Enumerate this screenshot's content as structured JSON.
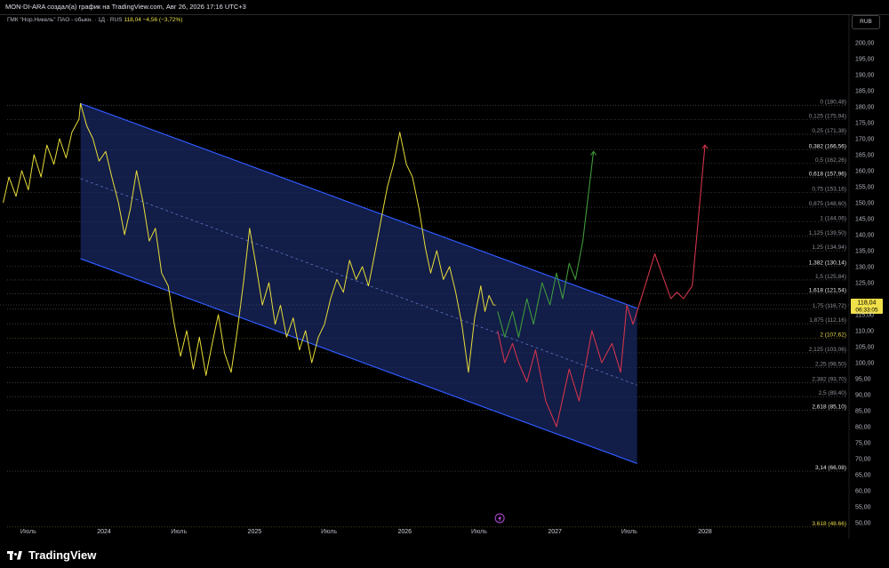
{
  "header": {
    "caption": "MON-DI-ARA создал(а) график на TradingView.com, Авг 26, 2026 17:16 UTC+3"
  },
  "legend": {
    "symbol": "ГМК \"Нор.Никель\" ПАО - обыкн. · 1Д · RUS",
    "price": "118,04",
    "change": "−4,56 (−3,72%)"
  },
  "currency_button": "RUB",
  "footer": {
    "brand": "TradingView"
  },
  "colors": {
    "price_line": "#e8dd3a",
    "channel_border": "#2f5bff",
    "channel_fill": "#1a2a66",
    "forecast_bull": "#3f9a3a",
    "forecast_bear": "#d0344a",
    "midline": "#5a74c0",
    "fib_dotted": "#5c5f66",
    "current_price_tag": "#f0e04a"
  },
  "chart_data": {
    "type": "line",
    "y_axis": {
      "min": 45,
      "max": 205,
      "ticks": [
        "200,00",
        "195,00",
        "190,00",
        "185,00",
        "180,00",
        "175,00",
        "170,00",
        "165,00",
        "160,00",
        "155,00",
        "150,00",
        "145,00",
        "140,00",
        "135,00",
        "130,00",
        "125,00",
        "120,00",
        "115,00",
        "110,00",
        "105,00",
        "100,00",
        "95,00",
        "90,00",
        "85,00",
        "80,00",
        "75,00",
        "70,00",
        "65,00",
        "60,00",
        "55,00",
        "50,00"
      ],
      "tick_values": [
        200,
        195,
        190,
        185,
        180,
        175,
        170,
        165,
        160,
        155,
        150,
        145,
        140,
        135,
        130,
        125,
        120,
        115,
        110,
        105,
        100,
        95,
        90,
        85,
        80,
        75,
        70,
        65,
        60,
        55,
        50
      ]
    },
    "x_axis": {
      "labels": [
        "Июль",
        "2024",
        "Июль",
        "2025",
        "Июль",
        "2026",
        "Июль",
        "2027",
        "Июль",
        "2028"
      ],
      "dates": [
        "2023-07-01",
        "2024-01-01",
        "2024-07-01",
        "2025-01-01",
        "2025-07-01",
        "2026-01-01",
        "2026-07-01",
        "2027-01-01",
        "2027-07-01",
        "2028-01-01"
      ],
      "year_labels": [
        "2024",
        "2025",
        "2026",
        "2027",
        "2028"
      ]
    },
    "current_price": {
      "value": "118,04",
      "countdown": "06:33:05",
      "numeric": 118.04
    },
    "fib_levels": [
      {
        "label": "0 (180,48)",
        "value": 180.48
      },
      {
        "label": "0,125 (175,94)",
        "value": 175.94
      },
      {
        "label": "0,25 (171,38)",
        "value": 171.38
      },
      {
        "label": "0,382 (166,56)",
        "value": 166.56,
        "highlight": true
      },
      {
        "label": "0,5 (162,26)",
        "value": 162.26
      },
      {
        "label": "0,618 (157,96)",
        "value": 157.96,
        "highlight": true
      },
      {
        "label": "0,75 (153,16)",
        "value": 153.16
      },
      {
        "label": "0,875 (148,60)",
        "value": 148.6
      },
      {
        "label": "1 (144,06)",
        "value": 144.06
      },
      {
        "label": "1,125 (139,50)",
        "value": 139.5
      },
      {
        "label": "1,25 (134,94)",
        "value": 134.94
      },
      {
        "label": "1,382 (130,14)",
        "value": 130.14,
        "highlight": true
      },
      {
        "label": "1,5 (125,84)",
        "value": 125.84
      },
      {
        "label": "1,618 (121,54)",
        "value": 121.54,
        "highlight": true
      },
      {
        "label": "1,75 (116,72)",
        "value": 116.72
      },
      {
        "label": "1,875 (112,16)",
        "value": 112.16
      },
      {
        "label": "2 (107,62)",
        "value": 107.62,
        "gold": true
      },
      {
        "label": "2,125 (103,06)",
        "value": 103.06
      },
      {
        "label": "2,25 (98,50)",
        "value": 98.5
      },
      {
        "label": "2,382 (93,70)",
        "value": 93.7
      },
      {
        "label": "2,5 (89,40)",
        "value": 89.4
      },
      {
        "label": "2,618 (85,10)",
        "value": 85.1,
        "highlight": true
      },
      {
        "label": "3,14 (66,08)",
        "value": 66.08,
        "highlight": true
      },
      {
        "label": "3.618 (48.66)",
        "value": 48.66,
        "gold": true
      }
    ],
    "channel": {
      "upper": [
        [
          "2023-11-05",
          181.0
        ],
        [
          "2027-07-20",
          117.0
        ]
      ],
      "lower": [
        [
          "2023-11-05",
          132.5
        ],
        [
          "2027-07-20",
          68.5
        ]
      ],
      "mid": [
        [
          "2023-11-05",
          157.5
        ],
        [
          "2027-07-20",
          93.0
        ]
      ]
    },
    "series": [
      {
        "key": "price",
        "values": [
          [
            "2023-05-01",
            150
          ],
          [
            "2023-05-15",
            158
          ],
          [
            "2023-06-01",
            152
          ],
          [
            "2023-06-15",
            160
          ],
          [
            "2023-07-01",
            154
          ],
          [
            "2023-07-15",
            165
          ],
          [
            "2023-08-01",
            158
          ],
          [
            "2023-08-15",
            168
          ],
          [
            "2023-09-01",
            162
          ],
          [
            "2023-09-15",
            170
          ],
          [
            "2023-10-01",
            164
          ],
          [
            "2023-10-15",
            172
          ],
          [
            "2023-11-01",
            176
          ],
          [
            "2023-11-05",
            181
          ],
          [
            "2023-11-20",
            174
          ],
          [
            "2023-12-05",
            170
          ],
          [
            "2023-12-20",
            163
          ],
          [
            "2024-01-05",
            166
          ],
          [
            "2024-01-20",
            158
          ],
          [
            "2024-02-05",
            150
          ],
          [
            "2024-02-20",
            140
          ],
          [
            "2024-03-05",
            148
          ],
          [
            "2024-03-20",
            160
          ],
          [
            "2024-04-05",
            150
          ],
          [
            "2024-04-20",
            138
          ],
          [
            "2024-05-05",
            142
          ],
          [
            "2024-05-20",
            128
          ],
          [
            "2024-06-05",
            124
          ],
          [
            "2024-06-20",
            112
          ],
          [
            "2024-07-05",
            102
          ],
          [
            "2024-07-20",
            110
          ],
          [
            "2024-08-05",
            98
          ],
          [
            "2024-08-20",
            108
          ],
          [
            "2024-09-05",
            96
          ],
          [
            "2024-09-20",
            106
          ],
          [
            "2024-10-05",
            115
          ],
          [
            "2024-10-20",
            103
          ],
          [
            "2024-11-05",
            97
          ],
          [
            "2024-11-20",
            110
          ],
          [
            "2024-12-05",
            125
          ],
          [
            "2024-12-20",
            142
          ],
          [
            "2025-01-05",
            130
          ],
          [
            "2025-01-20",
            118
          ],
          [
            "2025-02-05",
            125
          ],
          [
            "2025-02-20",
            112
          ],
          [
            "2025-03-05",
            118
          ],
          [
            "2025-03-20",
            108
          ],
          [
            "2025-04-05",
            114
          ],
          [
            "2025-04-20",
            104
          ],
          [
            "2025-05-05",
            110
          ],
          [
            "2025-05-20",
            100
          ],
          [
            "2025-06-05",
            108
          ],
          [
            "2025-06-20",
            112
          ],
          [
            "2025-07-05",
            120
          ],
          [
            "2025-07-20",
            126
          ],
          [
            "2025-08-05",
            122
          ],
          [
            "2025-08-20",
            132
          ],
          [
            "2025-09-05",
            126
          ],
          [
            "2025-09-20",
            130
          ],
          [
            "2025-10-05",
            124
          ],
          [
            "2025-10-20",
            134
          ],
          [
            "2025-11-05",
            145
          ],
          [
            "2025-11-20",
            155
          ],
          [
            "2025-12-05",
            162
          ],
          [
            "2025-12-20",
            172
          ],
          [
            "2026-01-05",
            162
          ],
          [
            "2026-01-20",
            158
          ],
          [
            "2026-02-05",
            148
          ],
          [
            "2026-02-20",
            136
          ],
          [
            "2026-03-05",
            128
          ],
          [
            "2026-03-20",
            135
          ],
          [
            "2026-04-05",
            126
          ],
          [
            "2026-04-20",
            130
          ],
          [
            "2026-05-05",
            122
          ],
          [
            "2026-05-20",
            112
          ],
          [
            "2026-06-05",
            97
          ],
          [
            "2026-06-20",
            114
          ],
          [
            "2026-07-05",
            124
          ],
          [
            "2026-07-15",
            116
          ],
          [
            "2026-07-25",
            121
          ],
          [
            "2026-08-05",
            118
          ],
          [
            "2026-08-10",
            118.04
          ]
        ]
      },
      {
        "key": "bull",
        "values": [
          [
            "2026-08-15",
            116
          ],
          [
            "2026-09-01",
            108
          ],
          [
            "2026-09-20",
            116
          ],
          [
            "2026-10-05",
            108
          ],
          [
            "2026-10-25",
            120
          ],
          [
            "2026-11-10",
            112
          ],
          [
            "2026-12-01",
            125
          ],
          [
            "2026-12-20",
            118
          ],
          [
            "2027-01-05",
            128
          ],
          [
            "2027-01-20",
            120
          ],
          [
            "2027-02-05",
            131
          ],
          [
            "2027-02-20",
            126
          ],
          [
            "2027-03-10",
            138
          ],
          [
            "2027-04-05",
            166
          ]
        ]
      },
      {
        "key": "bear",
        "values": [
          [
            "2026-08-15",
            110
          ],
          [
            "2026-09-01",
            100
          ],
          [
            "2026-09-20",
            106
          ],
          [
            "2026-10-05",
            100
          ],
          [
            "2026-10-25",
            94
          ],
          [
            "2026-11-15",
            104
          ],
          [
            "2026-12-10",
            88
          ],
          [
            "2027-01-05",
            80
          ],
          [
            "2027-02-05",
            98
          ],
          [
            "2027-03-01",
            88
          ],
          [
            "2027-04-01",
            110
          ],
          [
            "2027-04-25",
            100
          ],
          [
            "2027-05-20",
            106
          ],
          [
            "2027-06-10",
            97
          ],
          [
            "2027-06-25",
            118
          ],
          [
            "2027-07-10",
            112
          ],
          [
            "2027-07-20",
            116
          ],
          [
            "2027-09-01",
            134
          ],
          [
            "2027-10-10",
            120
          ],
          [
            "2027-10-25",
            122
          ],
          [
            "2027-11-10",
            120
          ],
          [
            "2027-12-01",
            124
          ],
          [
            "2028-01-01",
            168
          ]
        ]
      }
    ]
  }
}
